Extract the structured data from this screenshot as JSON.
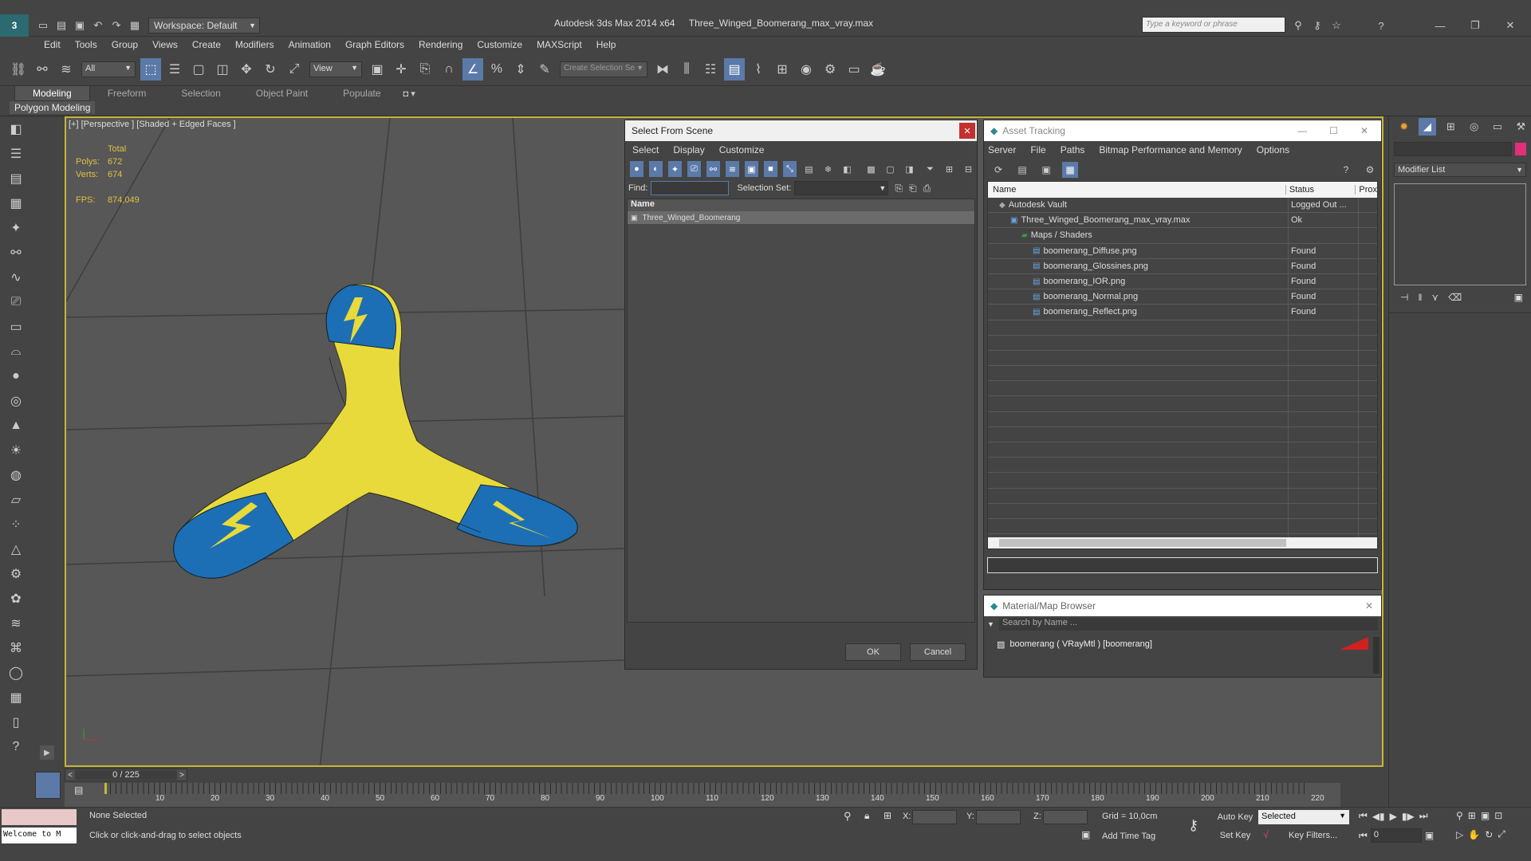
{
  "app": {
    "title": "Autodesk 3ds Max  2014 x64",
    "file": "Three_Winged_Boomerang_max_vray.max",
    "workspace": "Workspace: Default",
    "search_placeholder": "Type a keyword or phrase"
  },
  "menu": [
    "Edit",
    "Tools",
    "Group",
    "Views",
    "Create",
    "Modifiers",
    "Animation",
    "Graph Editors",
    "Rendering",
    "Customize",
    "MAXScript",
    "Help"
  ],
  "toolbar": {
    "filter_value": "All",
    "view_value": "View",
    "selection_set_placeholder": "Create Selection Se"
  },
  "ribbon": {
    "tabs": [
      "Modeling",
      "Freeform",
      "Selection",
      "Object Paint",
      "Populate"
    ],
    "sub_label": "Polygon Modeling"
  },
  "viewport": {
    "label": "[+] [Perspective ] [Shaded + Edged Faces ]",
    "total_label": "Total",
    "polys_label": "Polys:",
    "polys_value": "672",
    "verts_label": "Verts:",
    "verts_value": "674",
    "fps_label": "FPS:",
    "fps_value": "874,049"
  },
  "select_scene": {
    "title": "Select From Scene",
    "menu": [
      "Select",
      "Display",
      "Customize"
    ],
    "find_label": "Find:",
    "selection_set_label": "Selection Set:",
    "column_name": "Name",
    "item": "Three_Winged_Boomerang",
    "ok": "OK",
    "cancel": "Cancel"
  },
  "asset_tracking": {
    "title": "Asset Tracking",
    "menu": [
      "Server",
      "File",
      "Paths",
      "Bitmap Performance and Memory",
      "Options"
    ],
    "col_name": "Name",
    "col_status": "Status",
    "col_prox": "Prox",
    "rows": [
      {
        "name": "Autodesk Vault",
        "status": "Logged Out ..."
      },
      {
        "name": "Three_Winged_Boomerang_max_vray.max",
        "status": "Ok"
      },
      {
        "name": "Maps / Shaders",
        "status": ""
      },
      {
        "name": "boomerang_Diffuse.png",
        "status": "Found"
      },
      {
        "name": "boomerang_Glossines.png",
        "status": "Found"
      },
      {
        "name": "boomerang_IOR.png",
        "status": "Found"
      },
      {
        "name": "boomerang_Normal.png",
        "status": "Found"
      },
      {
        "name": "boomerang_Reflect.png",
        "status": "Found"
      }
    ]
  },
  "material_browser": {
    "title": "Material/Map Browser",
    "search_placeholder": "Search by Name ...",
    "item": "boomerang ( VRayMtl ) [boomerang]"
  },
  "right_panel": {
    "modifier_list": "Modifier List"
  },
  "timeline": {
    "frame": "0 / 225",
    "ticks": [
      "10",
      "20",
      "30",
      "40",
      "50",
      "60",
      "70",
      "80",
      "90",
      "100",
      "110",
      "120",
      "130",
      "140",
      "150",
      "160",
      "170",
      "180",
      "190",
      "200",
      "210",
      "220"
    ]
  },
  "status": {
    "maxscript": "Welcome to M",
    "selected": "None Selected",
    "prompt": "Click or click-and-drag to select objects",
    "x_label": "X:",
    "y_label": "Y:",
    "z_label": "Z:",
    "grid": "Grid = 10,0cm",
    "add_time_tag": "Add Time Tag",
    "auto_key": "Auto Key",
    "auto_key_value": "Selected",
    "set_key": "Set Key",
    "key_filters": "Key Filters...",
    "frame_value": "0"
  },
  "colors": {
    "viewport_border": "#c8b536",
    "boomerang_yellow": "#e8da3a",
    "boomerang_blue": "#1c6fb5",
    "accent": "#5b7aa8"
  }
}
